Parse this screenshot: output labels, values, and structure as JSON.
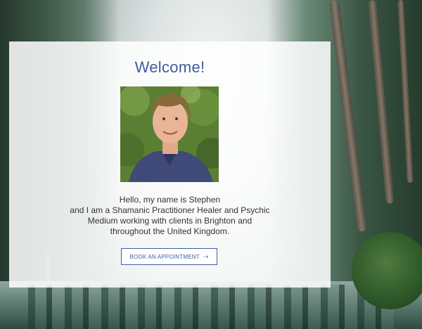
{
  "welcome": {
    "heading": "Welcome!"
  },
  "profile": {
    "photo_icon": "portrait-photo"
  },
  "intro": {
    "lines": [
      "Hello, my name is Stephen",
      "and I am a Shamanic Practitioner Healer and Psychic",
      "Medium working with clients in Brighton and",
      "throughout the United Kingdom."
    ]
  },
  "cta": {
    "label": "BOOK AN APPOINTMENT",
    "icon": "arrow-right-icon"
  },
  "colors": {
    "accent": "#3f5e9c",
    "text": "#333333",
    "card_background": "#ffffff"
  }
}
